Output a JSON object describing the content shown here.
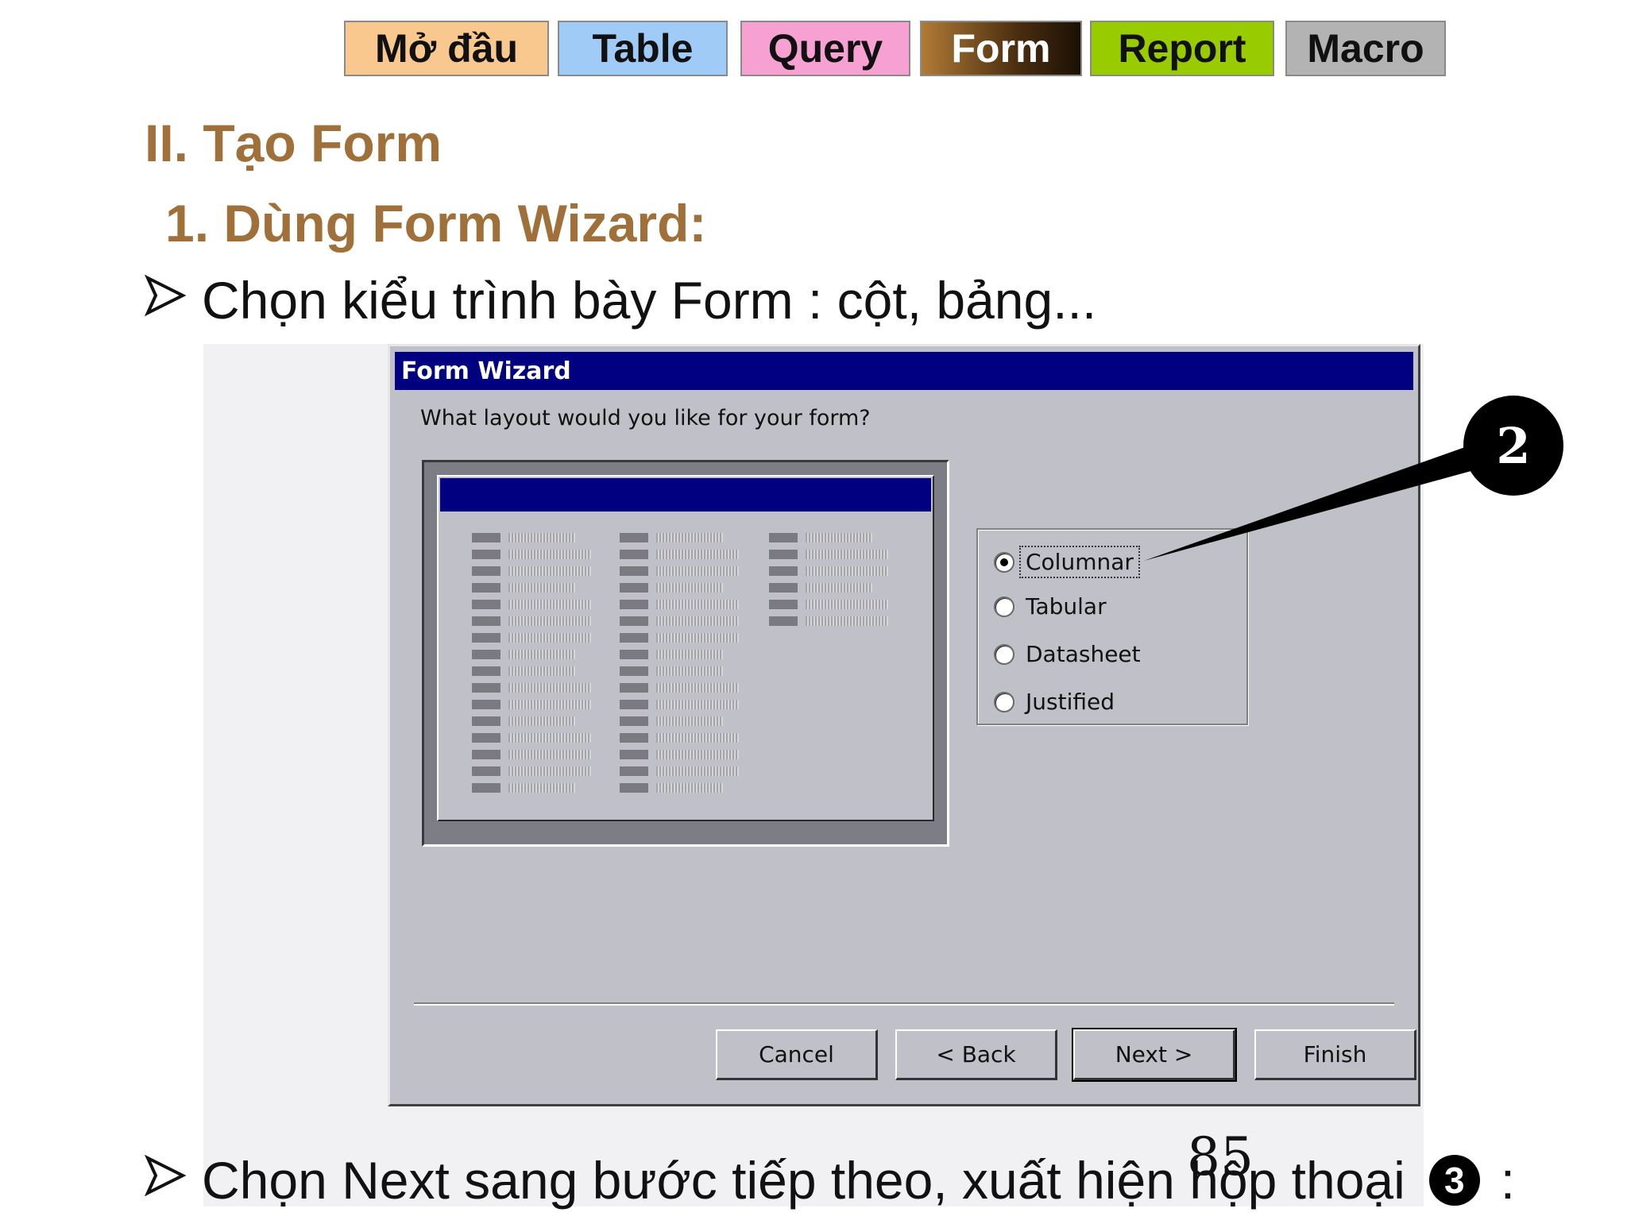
{
  "nav": {
    "tabs": [
      {
        "label": "Mở đầu",
        "color": "#f9c88f"
      },
      {
        "label": "Table",
        "color": "#9fcbf6"
      },
      {
        "label": "Query",
        "color": "#f7a1d3"
      },
      {
        "label": "Form",
        "color": "#4a2e10",
        "active": true
      },
      {
        "label": "Report",
        "color": "#99cc00"
      },
      {
        "label": "Macro",
        "color": "#b3b3b3"
      }
    ]
  },
  "slide": {
    "section_title": "II. Tạo Form",
    "subsection_title": "1. Dùng Form Wizard:",
    "bullet_1": "Chọn kiểu trình bày Form : cột, bảng...",
    "bullet_2_text": "Chọn Next sang bước tiếp theo, xuất hiện hộp thoại",
    "bullet_2_step": "3",
    "bullet_2_suffix": ":",
    "bullet_icon": "arrow-bullet-icon",
    "page_number": "85",
    "heading_color": "#a0703a"
  },
  "wizard": {
    "title": "Form Wizard",
    "question": "What layout would you like for your form?",
    "layout_options": [
      {
        "label": "Columnar",
        "mnemonic": "C",
        "selected": true
      },
      {
        "label": "Tabular",
        "mnemonic": "T",
        "selected": false
      },
      {
        "label": "Datasheet",
        "mnemonic": "D",
        "selected": false
      },
      {
        "label": "Justified",
        "mnemonic": "J",
        "selected": false
      }
    ],
    "buttons": {
      "cancel": "Cancel",
      "back": "< Back",
      "next": "Next >",
      "finish": "Finish"
    },
    "callout_label": "2",
    "titlebar_color": "#000080"
  }
}
